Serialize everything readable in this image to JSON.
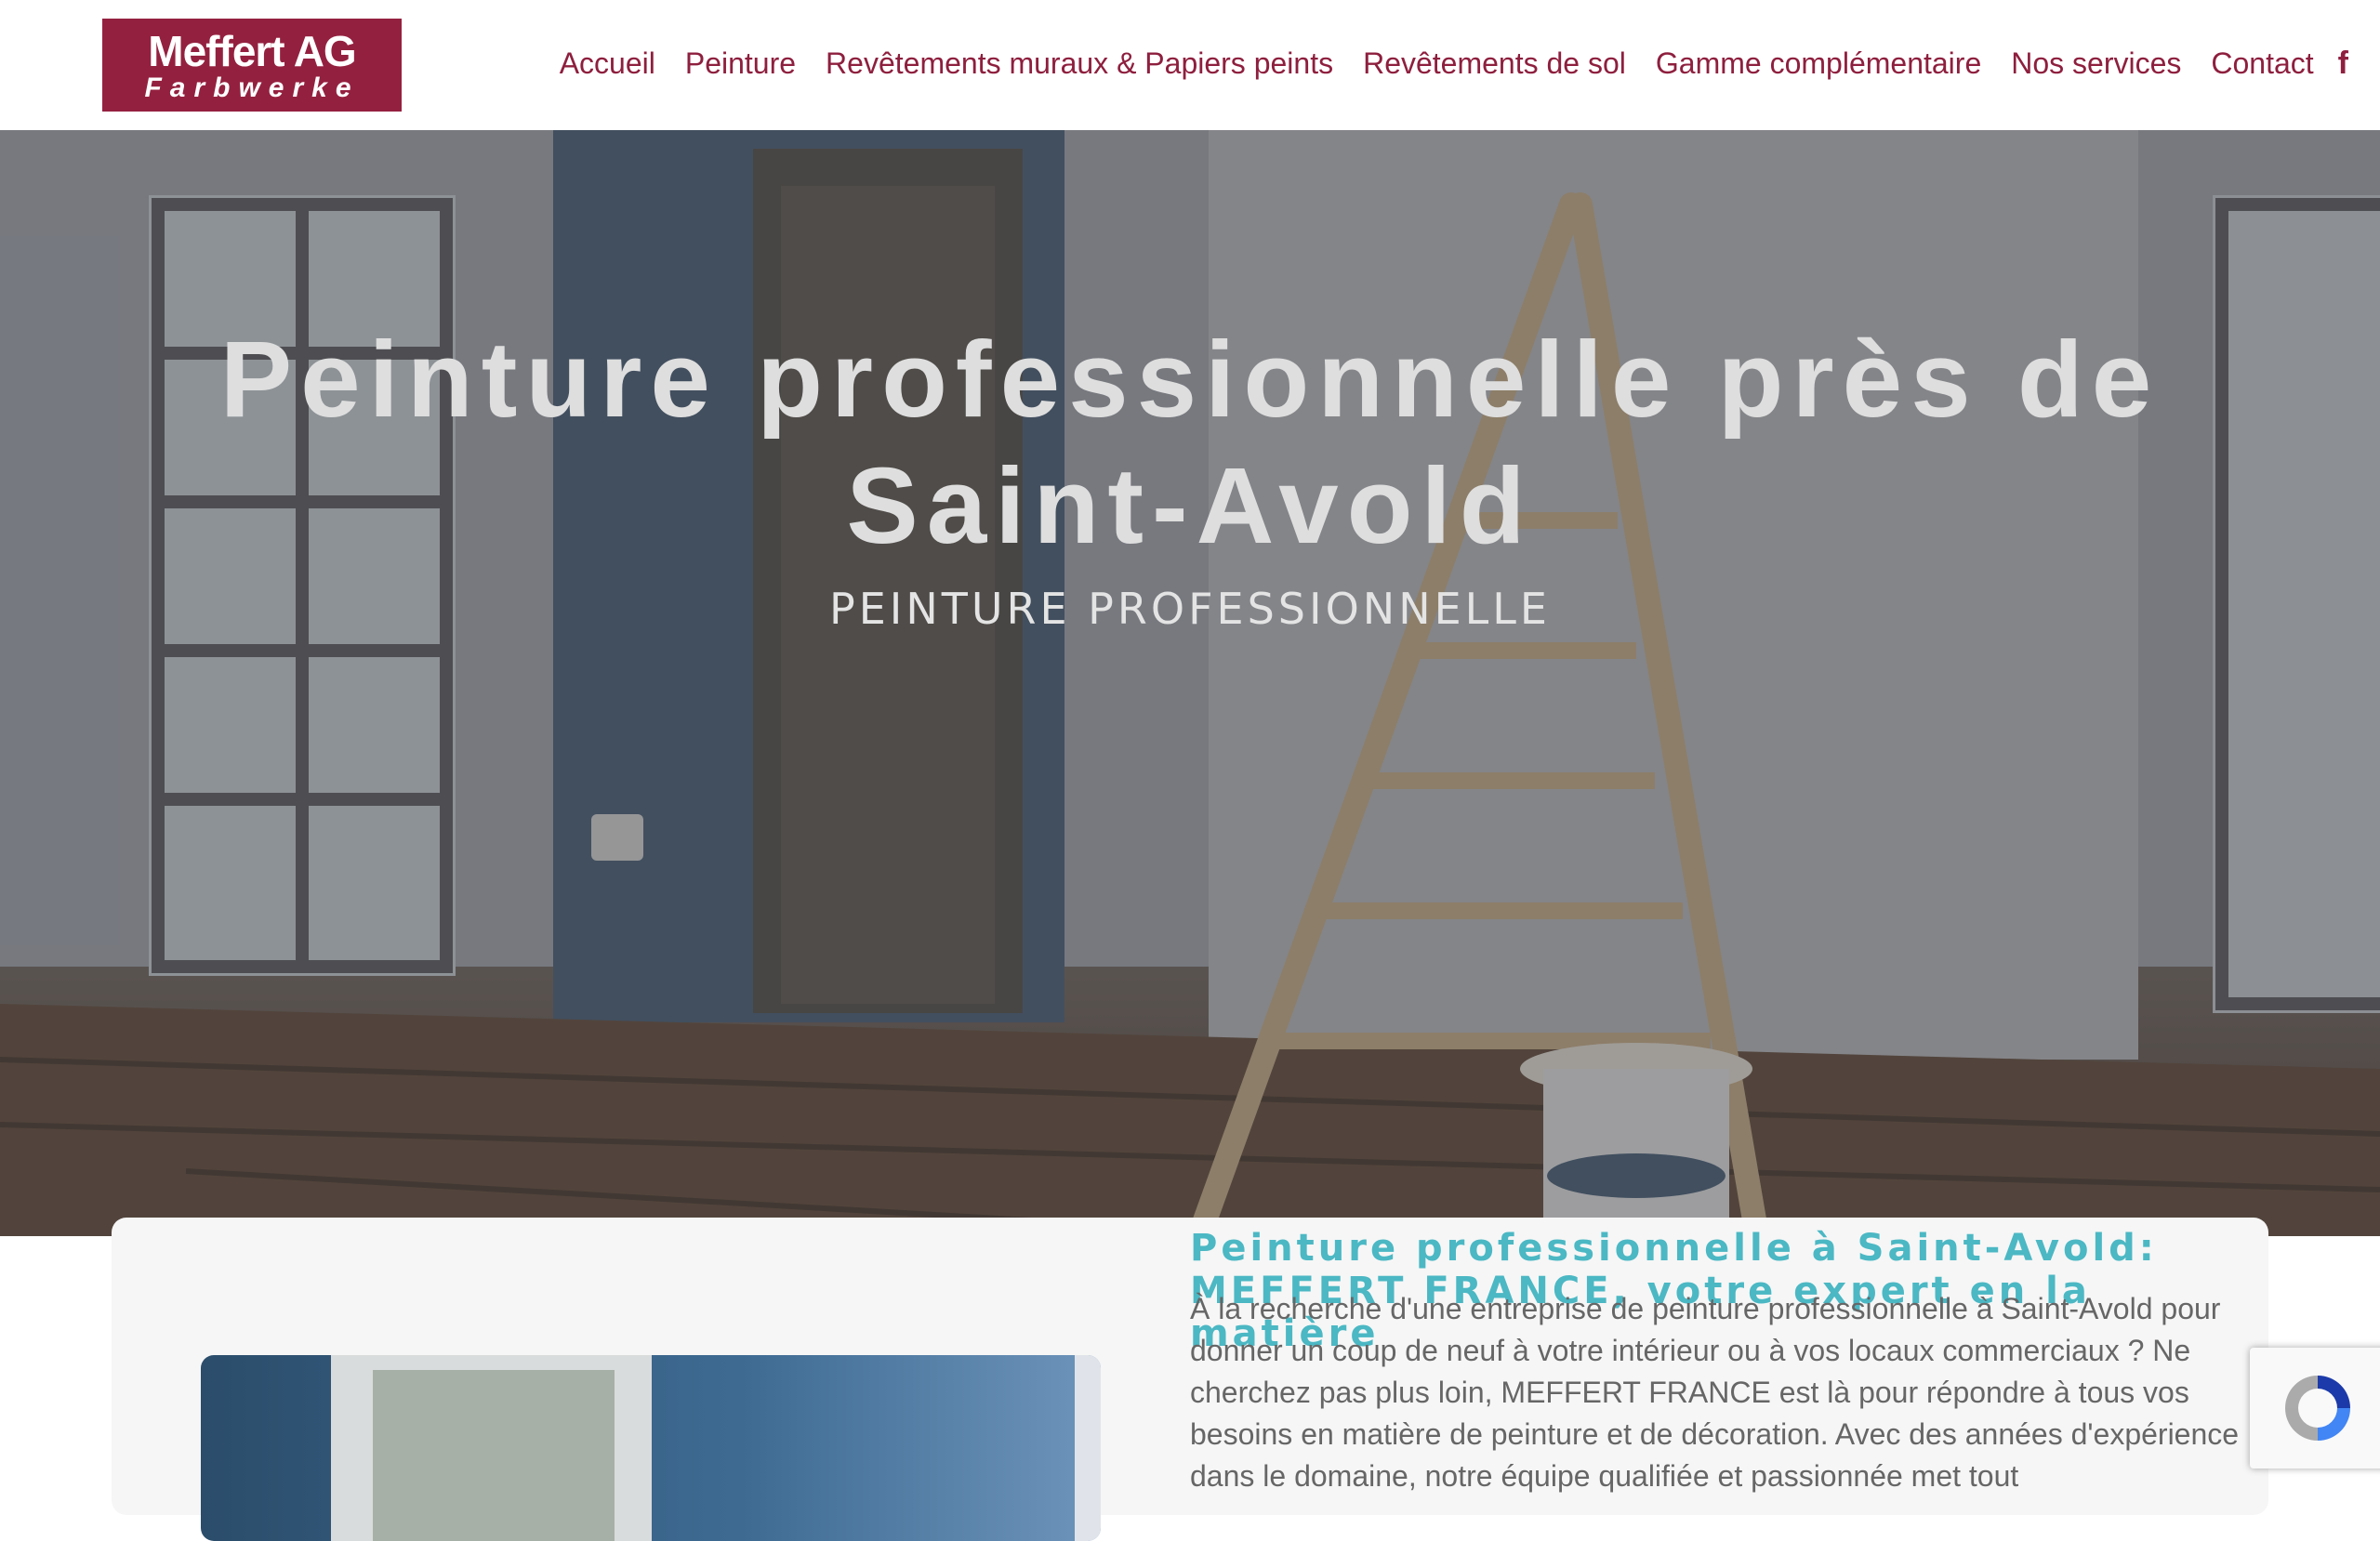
{
  "brand": {
    "name": "Meffert AG",
    "tagline": "Farbwerke",
    "color": "#94203f"
  },
  "nav": {
    "items": [
      {
        "label": "Accueil"
      },
      {
        "label": "Peinture"
      },
      {
        "label": "Revêtements muraux & Papiers peints"
      },
      {
        "label": "Revêtements de sol"
      },
      {
        "label": "Gamme complémentaire"
      },
      {
        "label": "Nos services"
      },
      {
        "label": "Contact"
      }
    ],
    "social_icon": "facebook-icon",
    "social_glyph": "f",
    "link_color": "#8e1f3e"
  },
  "hero": {
    "title_line1": "Peinture professionnelle près de",
    "title_line2": "Saint-Avold",
    "subtitle": "PEINTURE PROFESSIONNELLE"
  },
  "intro": {
    "title_line1": "Peinture professionnelle à Saint-Avold:",
    "title_line2": "MEFFERT FRANCE, votre expert en la matière",
    "text": "À la recherche d'une entreprise de peinture professionnelle à Saint-Avold pour donner un coup de neuf à votre intérieur ou à vos locaux commerciaux ? Ne cherchez pas plus loin, MEFFERT FRANCE est là pour répondre à tous vos besoins en matière de peinture et de décoration. Avec des années d'expérience dans le domaine, notre équipe qualifiée et passionnée met tout",
    "title_color": "#4bb8c4"
  },
  "recaptcha": {
    "icon": "recaptcha-icon"
  }
}
